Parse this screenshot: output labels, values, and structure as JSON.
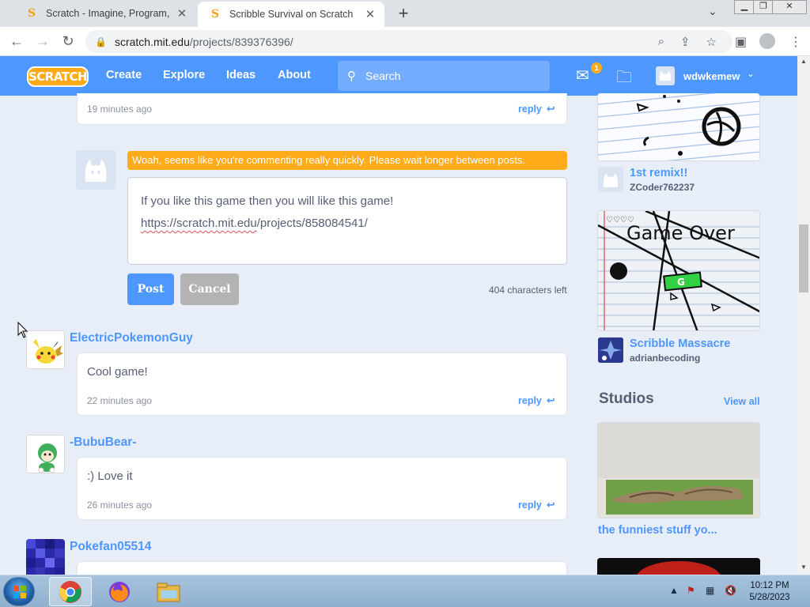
{
  "browser": {
    "tabs": [
      {
        "title": "Scratch - Imagine, Program, Share",
        "active": false
      },
      {
        "title": "Scribble Survival on Scratch",
        "active": true
      }
    ],
    "url_host": "scratch.mit.edu",
    "url_path": "/projects/839376396/"
  },
  "header": {
    "logo": "SCRATCH",
    "nav": [
      "Create",
      "Explore",
      "Ideas",
      "About"
    ],
    "search_placeholder": "Search",
    "messages_count": "1",
    "username": "wdwkemew"
  },
  "comments_top": {
    "time": "19 minutes ago",
    "reply": "reply"
  },
  "compose": {
    "warning": "Woah, seems like you're commenting really quickly. Please wait longer between posts.",
    "line1": "If you like this game then you will like this game!",
    "url_part1": "https://scratch.mit.edu",
    "url_part2": "/projects/858084541/",
    "post_label": "Post",
    "cancel_label": "Cancel",
    "chars_left": "404 characters left"
  },
  "comments": [
    {
      "user": "ElectricPokemonGuy",
      "text": "Cool game!",
      "time": "22 minutes ago",
      "reply": "reply"
    },
    {
      "user": "-BubuBear-",
      "text": ":) Love it",
      "time": "26 minutes ago",
      "reply": "reply"
    },
    {
      "user": "Pokefan05514"
    }
  ],
  "sidebar": {
    "remixes": [
      {
        "title": "1st remix!!",
        "author": "ZCoder762237"
      },
      {
        "title": "Scribble Massacre",
        "author": "adrianbecoding"
      }
    ],
    "game_over_text": "Game Over",
    "studios_heading": "Studios",
    "view_all": "View all",
    "studio_title": "the funniest stuff yo..."
  },
  "taskbar": {
    "time": "10:12 PM",
    "date": "5/28/2023"
  },
  "colors": {
    "scratch_blue": "#4d97ff",
    "warning_orange": "#ffab1a",
    "page_bg": "#e8eef8"
  }
}
